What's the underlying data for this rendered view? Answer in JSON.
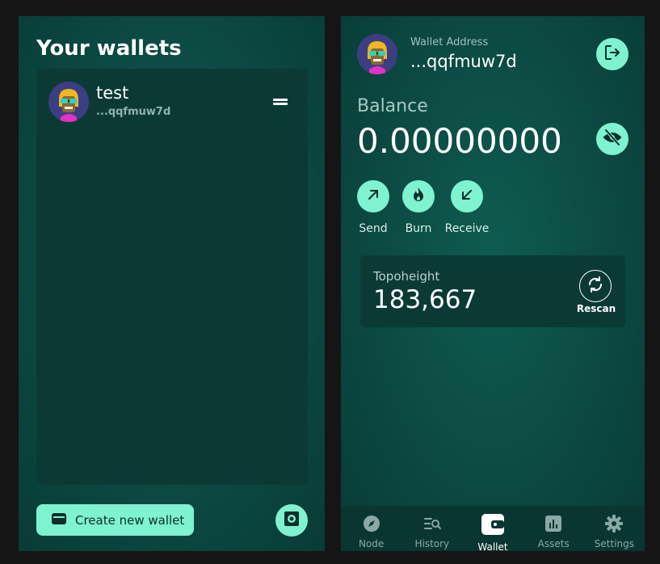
{
  "wallets_panel": {
    "title": "Your wallets",
    "wallets": [
      {
        "name": "test",
        "address": "...qqfmuw7d"
      }
    ],
    "create_button_label": "Create new wallet"
  },
  "wallet_panel": {
    "address_label": "Wallet Address",
    "address_value": "...qqfmuw7d",
    "balance_label": "Balance",
    "balance_value": "0.00000000",
    "actions": [
      {
        "label": "Send",
        "icon": "arrow-up-right-icon"
      },
      {
        "label": "Burn",
        "icon": "flame-icon"
      },
      {
        "label": "Receive",
        "icon": "arrow-down-left-icon"
      }
    ],
    "topoheight_label": "Topoheight",
    "topoheight_value": "183,667",
    "rescan_label": "Rescan"
  },
  "bottom_nav": {
    "active": "Wallet",
    "items": [
      {
        "label": "Node",
        "icon": "compass-icon"
      },
      {
        "label": "History",
        "icon": "search-list-icon"
      },
      {
        "label": "Wallet",
        "icon": "wallet-icon"
      },
      {
        "label": "Assets",
        "icon": "chart-icon"
      },
      {
        "label": "Settings",
        "icon": "gear-icon"
      }
    ]
  },
  "colors": {
    "accent": "#7ff2cf",
    "panel": "#0c4d45",
    "card": "#0b3a35",
    "background": "#151515"
  }
}
